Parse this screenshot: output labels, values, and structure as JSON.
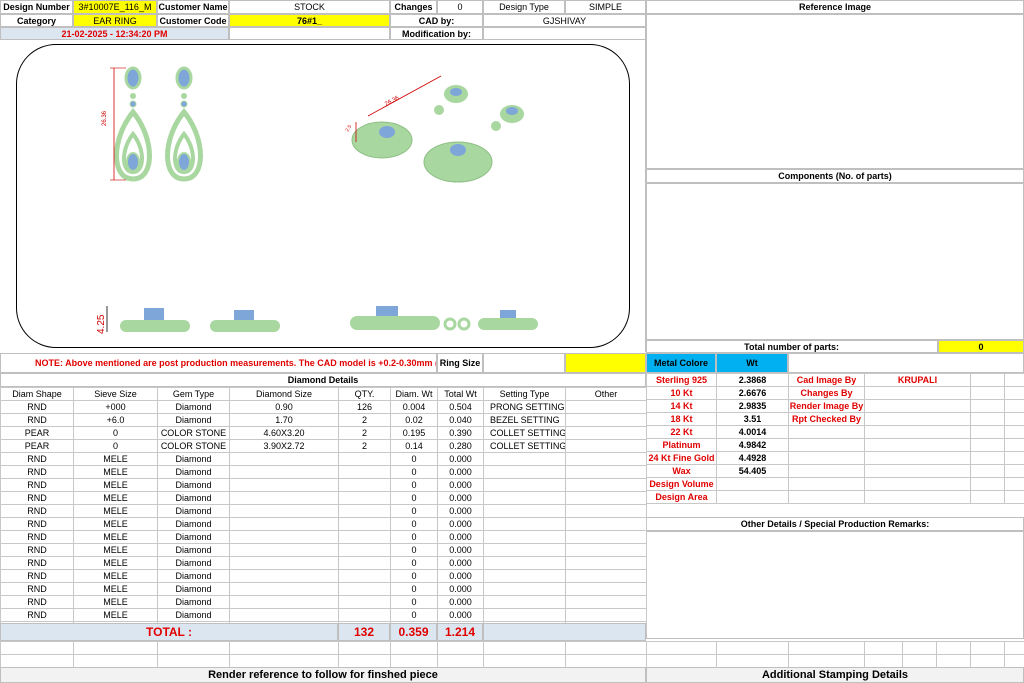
{
  "header": {
    "design_number_label": "Design Number",
    "design_number": "3#10007E_116_M",
    "customer_name_label": "Customer Name",
    "customer_name": "STOCK",
    "changes_label": "Changes",
    "changes": "0",
    "design_type_label": "Design Type",
    "design_type": "SIMPLE",
    "category_label": "Category",
    "category": "EAR RING",
    "customer_code_label": "Customer Code",
    "customer_code": "76#1_",
    "cad_by_label": "CAD by:",
    "cad_by": "GJSHIVAY",
    "timestamp": "21-02-2025 - 12:34:20 PM",
    "modification_by_label": "Modification by:",
    "reference_image_label": "Reference Image"
  },
  "drawing": {
    "dim_height_front": "26.36",
    "dim_height_iso": "26.36",
    "dim_width_iso": "2.5",
    "dim_side": "4.25"
  },
  "components": {
    "title": "Components (No. of parts)",
    "total_label": "Total number of parts:",
    "total": "0"
  },
  "note": {
    "text": "NOTE: Above mentioned are post production measurements. The CAD model is +0.2-0.30mm (loss)",
    "ring_size_label": "Ring Size"
  },
  "diamond": {
    "title": "Diamond Details",
    "columns": [
      "Diam Shape",
      "Sieve Size",
      "Gem Type",
      "Diamond Size",
      "QTY.",
      "Diam. Wt",
      "Total Wt",
      "Setting Type",
      "Other"
    ],
    "rows": [
      [
        "RND",
        "+000",
        "Diamond",
        "0.90",
        "126",
        "0.004",
        "0.504",
        "PRONG SETTING",
        ""
      ],
      [
        "RND",
        "+6.0",
        "Diamond",
        "1.70",
        "2",
        "0.02",
        "0.040",
        "BEZEL SETTING",
        ""
      ],
      [
        "PEAR",
        "0",
        "COLOR STONE",
        "4.60X3.20",
        "2",
        "0.195",
        "0.390",
        "COLLET SETTING",
        ""
      ],
      [
        "PEAR",
        "0",
        "COLOR STONE",
        "3.90X2.72",
        "2",
        "0.14",
        "0.280",
        "COLLET SETTING",
        ""
      ],
      [
        "RND",
        "MELE",
        "Diamond",
        "",
        "",
        "0",
        "0.000",
        "",
        ""
      ],
      [
        "RND",
        "MELE",
        "Diamond",
        "",
        "",
        "0",
        "0.000",
        "",
        ""
      ],
      [
        "RND",
        "MELE",
        "Diamond",
        "",
        "",
        "0",
        "0.000",
        "",
        ""
      ],
      [
        "RND",
        "MELE",
        "Diamond",
        "",
        "",
        "0",
        "0.000",
        "",
        ""
      ],
      [
        "RND",
        "MELE",
        "Diamond",
        "",
        "",
        "0",
        "0.000",
        "",
        ""
      ],
      [
        "RND",
        "MELE",
        "Diamond",
        "",
        "",
        "0",
        "0.000",
        "",
        ""
      ],
      [
        "RND",
        "MELE",
        "Diamond",
        "",
        "",
        "0",
        "0.000",
        "",
        ""
      ],
      [
        "RND",
        "MELE",
        "Diamond",
        "",
        "",
        "0",
        "0.000",
        "",
        ""
      ],
      [
        "RND",
        "MELE",
        "Diamond",
        "",
        "",
        "0",
        "0.000",
        "",
        ""
      ],
      [
        "RND",
        "MELE",
        "Diamond",
        "",
        "",
        "0",
        "0.000",
        "",
        ""
      ],
      [
        "RND",
        "MELE",
        "Diamond",
        "",
        "",
        "0",
        "0.000",
        "",
        ""
      ],
      [
        "RND",
        "MELE",
        "Diamond",
        "",
        "",
        "0",
        "0.000",
        "",
        ""
      ],
      [
        "RND",
        "MELE",
        "Diamond",
        "",
        "",
        "0",
        "0.000",
        "",
        ""
      ],
      [
        "RND",
        "MELE",
        "Diamond",
        "",
        "",
        "0",
        "0.000",
        "",
        ""
      ]
    ],
    "total_label": "TOTAL :",
    "total_qty": "132",
    "total_diam_wt": "0.359",
    "total_wt": "1.214"
  },
  "metal": {
    "metal_colore_label": "Metal Colore",
    "wt_label": "Wt",
    "rows": [
      {
        "name": "Sterling 925",
        "wt": "2.3868",
        "right_label": "Cad Image By",
        "right_value": "KRUPALI"
      },
      {
        "name": "10 Kt",
        "wt": "2.6676",
        "right_label": "Changes By",
        "right_value": ""
      },
      {
        "name": "14 Kt",
        "wt": "2.9835",
        "right_label": "Render Image By",
        "right_value": ""
      },
      {
        "name": "18 Kt",
        "wt": "3.51",
        "right_label": "Rpt Checked By",
        "right_value": ""
      },
      {
        "name": "22 Kt",
        "wt": "4.0014",
        "right_label": "",
        "right_value": ""
      },
      {
        "name": "Platinum",
        "wt": "4.9842",
        "right_label": "",
        "right_value": ""
      },
      {
        "name": "24 Kt Fine Gold",
        "wt": "4.4928",
        "right_label": "",
        "right_value": ""
      },
      {
        "name": "Wax",
        "wt": "54.405",
        "right_label": "",
        "right_value": ""
      },
      {
        "name": "Design Volume",
        "wt": "",
        "right_label": "",
        "right_value": ""
      },
      {
        "name": "Design Area",
        "wt": "",
        "right_label": "",
        "right_value": ""
      }
    ],
    "other_details_label": "Other Details / Special Production Remarks:"
  },
  "footer": {
    "render_reference": "Render reference to follow for finshed piece",
    "additional_stamping": "Additional Stamping Details"
  },
  "colors": {
    "yellow": "#ffff00",
    "light_blue": "#dce6f1",
    "metal_blue": "#00b0f0",
    "red_text": "#e00000",
    "earring_metal": "#a9d7a0",
    "stone_blue": "#7ea6d8"
  }
}
